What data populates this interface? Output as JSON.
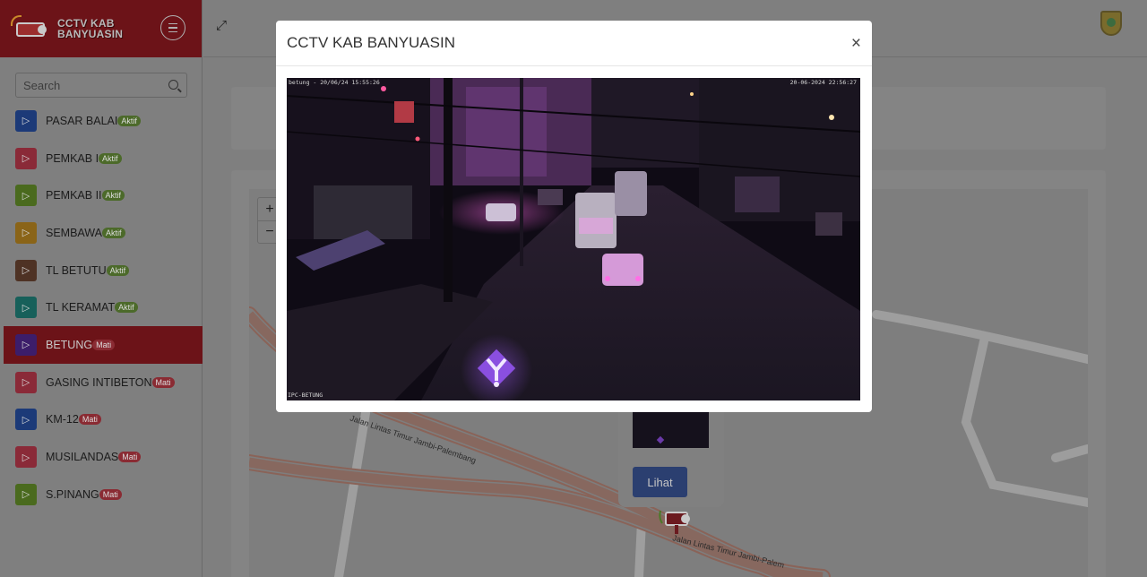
{
  "sidebar": {
    "brand_line1": "CCTV KAB",
    "brand_line2": "BANYUASIN",
    "search_placeholder": "Search",
    "items": [
      {
        "label": "PASAR BALAI",
        "status": "Aktif",
        "color": "#1c3a78"
      },
      {
        "label": "PEMKAB I",
        "status": "Aktif",
        "color": "#8a2a38"
      },
      {
        "label": "PEMKAB II",
        "status": "Aktif",
        "color": "#4a6a1e"
      },
      {
        "label": "SEMBAWA",
        "status": "Aktif",
        "color": "#8a6418"
      },
      {
        "label": "TL BETUTU",
        "status": "Aktif",
        "color": "#4e3224"
      },
      {
        "label": "TL KERAMAT",
        "status": "Aktif",
        "color": "#17605a"
      },
      {
        "label": "BETUNG",
        "status": "Mati",
        "color": "#3c1d6a"
      },
      {
        "label": "GASING INTIBETON",
        "status": "Mati",
        "color": "#8a2a38"
      },
      {
        "label": "KM-12",
        "status": "Mati",
        "color": "#1c3a78"
      },
      {
        "label": "MUSILANDAS",
        "status": "Mati",
        "color": "#8a2a38"
      },
      {
        "label": "S.PINANG",
        "status": "Mati",
        "color": "#4a6a1e"
      }
    ]
  },
  "map": {
    "road_label_1": "Jalan Lintas Timur Jambi-Palembang",
    "road_label_2": "Jalan Lintas Timur Jambi-Palem",
    "popup_button": "Lihat"
  },
  "modal": {
    "title": "CCTV KAB BANYUASIN",
    "close_symbol": "×",
    "osd_top_left": "betung - 20/06/24 15:55:26",
    "osd_top_right": "20-06-2024 22:56:27",
    "osd_bottom_left": "IPC-BETUNG"
  },
  "colors": {
    "brand": "#6c1318",
    "badge_on": "#4c6a2a",
    "badge_off": "#8a2b33",
    "button": "#2b3f70"
  }
}
